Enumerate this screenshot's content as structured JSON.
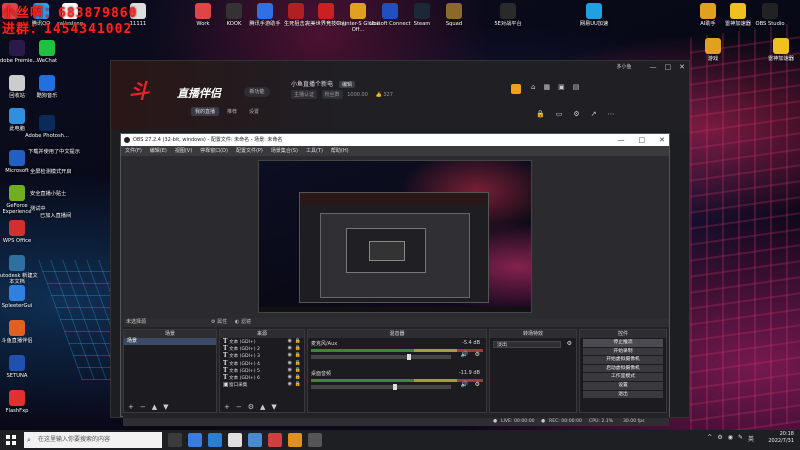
{
  "watermark": {
    "line1": "小丝啊：683879860",
    "line2": "进群：1454341002"
  },
  "desktop": {
    "top_row": [
      {
        "label": "",
        "color": "#e04545"
      },
      {
        "label": "腾讯QQ",
        "color": "#2aa0f0"
      },
      {
        "label": "calleslang",
        "color": "#ffffff"
      },
      {
        "label": "11111",
        "color": "#dddddd"
      },
      {
        "label": "Work",
        "color": "#e04545"
      },
      {
        "label": "KOOK",
        "color": "#333333"
      },
      {
        "label": "腾讯手游助手",
        "color": "#3070e0"
      },
      {
        "label": "生死狙击2",
        "color": "#b02020"
      },
      {
        "label": "完美世界竞技平台",
        "color": "#cc2020"
      },
      {
        "label": "Counter-S Global Off...",
        "color": "#e0a020"
      },
      {
        "label": "Ubisoft Connect",
        "color": "#2050c0"
      },
      {
        "label": "Steam",
        "color": "#1b2838"
      },
      {
        "label": "Squad",
        "color": "#8a6a2a"
      },
      {
        "label": "5E对战平台",
        "color": "#2a2a2a"
      },
      {
        "label": "网易UU加速",
        "color": "#20a0e0"
      },
      {
        "label": "AI助手",
        "color": "#e0a020"
      },
      {
        "label": "雷神加速器",
        "color": "#f0c020"
      },
      {
        "label": "OBS Studio",
        "color": "#222222"
      }
    ],
    "left_col": [
      {
        "label": "Adobe Premie...",
        "color": "#2a1a4a"
      },
      {
        "label": "WeChat",
        "color": "#20c040"
      },
      {
        "label": "回收站",
        "color": "#cccccc"
      },
      {
        "label": "酷狗音乐",
        "color": "#2070e0"
      },
      {
        "label": "此电脑",
        "color": "#3090e0"
      },
      {
        "label": "控制面板",
        "color": "#3060c0"
      },
      {
        "label": "Adobe Photosh...",
        "color": "#0a2a5a"
      },
      {
        "label": "Microsoft",
        "color": "#2060c0"
      },
      {
        "label": "GeForce Experience",
        "color": "#70b020"
      },
      {
        "label": "WPS Office",
        "color": "#d03030"
      },
      {
        "label": "Autodesk 新建文本文档",
        "color": "#3070a0"
      },
      {
        "label": "SpleeterGui",
        "color": "#3080e0"
      },
      {
        "label": "斗鱼直播伴侣",
        "color": "#e06020"
      },
      {
        "label": "SETUNA",
        "color": "#2050b0"
      },
      {
        "label": "FlashFxp",
        "color": "#e03030"
      }
    ],
    "right_col": [
      {
        "label": "游戏",
        "color": "#e0a020"
      },
      {
        "label": "雷神加速器",
        "color": "#f0c020"
      }
    ],
    "tips": [
      "下载并使用了中文提示",
      "全屏检测模式开启",
      "安全直播小贴士",
      "测试中",
      "已加入直播间"
    ]
  },
  "live_app": {
    "logo_mark": "斗",
    "logo_text": "直播伴侣",
    "version_pill": "新功能",
    "tabs": [
      "我的直播",
      "推荐",
      "设置"
    ],
    "room_title": "小鱼直播个新电",
    "room_tag": "编辑",
    "room_sub": [
      "主播认证",
      "粉丝数",
      "1000.00",
      "327"
    ],
    "user": "多小鱼",
    "window_controls": [
      "—",
      "□",
      "✕"
    ]
  },
  "obs": {
    "title": "OBS 27.2.4 (32-bit, windows) - 配置文件: 未命名 - 场景: 未命名",
    "title_controls": [
      "—",
      "□",
      "✕"
    ],
    "menu": [
      "文件(F)",
      "编辑(E)",
      "视图(V)",
      "停靠窗口(D)",
      "配置文件(P)",
      "场景集合(S)",
      "工具(T)",
      "帮助(H)"
    ],
    "source_header": "未选择源",
    "props_label": "属性",
    "filters_label": "滤镜",
    "panels": {
      "scenes": {
        "title": "场景",
        "items": [
          "场景"
        ]
      },
      "sources": {
        "title": "来源",
        "items": [
          "文本 (GDI+)",
          "文本 (GDI+) 2",
          "文本 (GDI+) 3",
          "文本 (GDI+) 4",
          "文本 (GDI+) 5",
          "文本 (GDI+) 6",
          "窗口采集"
        ]
      },
      "mixer": {
        "title": "混音器",
        "tracks": [
          {
            "name": "麦克风/Aux",
            "db": "-5.4 dB"
          },
          {
            "name": "桌面音频",
            "db": "-11.9 dB"
          }
        ]
      },
      "transitions": {
        "title": "转场特效",
        "selected": "淡出"
      },
      "controls": {
        "title": "控件",
        "buttons": [
          "停止推流",
          "开始录制",
          "开始虚拟摄像机",
          "启动虚拟摄像机",
          "工作室模式",
          "设置",
          "退出"
        ]
      }
    },
    "status": {
      "live": "LIVE: 00:00:00",
      "rec": "REC: 00:00:00",
      "cpu": "CPU: 2.1%",
      "fps": "30.00 fps"
    }
  },
  "taskbar": {
    "search_placeholder": "在这里输入你要搜索的内容",
    "apps": [
      "#3a3a3a",
      "#3a7be0",
      "#2c7fd0",
      "#e0e0e0",
      "#4a8ad0",
      "#d04040",
      "#e09020",
      "#555555"
    ],
    "time": "20:18",
    "date": "2022/7/31",
    "tray": [
      "^",
      "⚙",
      "◉",
      "✎",
      "英"
    ]
  }
}
